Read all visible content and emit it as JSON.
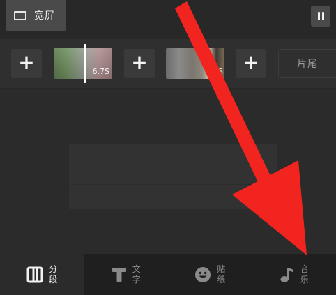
{
  "topbar": {
    "widescreen_label": "宽屏",
    "widescreen_icon": "aspect-ratio-icon",
    "pause_icon": "pause-icon"
  },
  "timeline": {
    "add_label": "+",
    "clips": [
      {
        "duration": "6.7S"
      },
      {
        "duration": "S"
      }
    ],
    "outro_label": "片尾"
  },
  "toolbar": {
    "items": [
      {
        "name": "segment",
        "line1": "分",
        "line2": "段",
        "icon": "columns-icon",
        "active": true
      },
      {
        "name": "text",
        "line1": "文",
        "line2": "字",
        "icon": "text-t-icon",
        "active": false
      },
      {
        "name": "sticker",
        "line1": "贴",
        "line2": "纸",
        "icon": "smiley-icon",
        "active": false
      },
      {
        "name": "music",
        "line1": "音",
        "line2": "乐",
        "icon": "music-note-icon",
        "active": false
      }
    ]
  },
  "colors": {
    "background": "#2b2b2b",
    "toolbar": "#1f1f1f",
    "arrow": "#f2241f",
    "active_text": "#f2f2f2",
    "inactive_text": "#8a8a8a"
  }
}
